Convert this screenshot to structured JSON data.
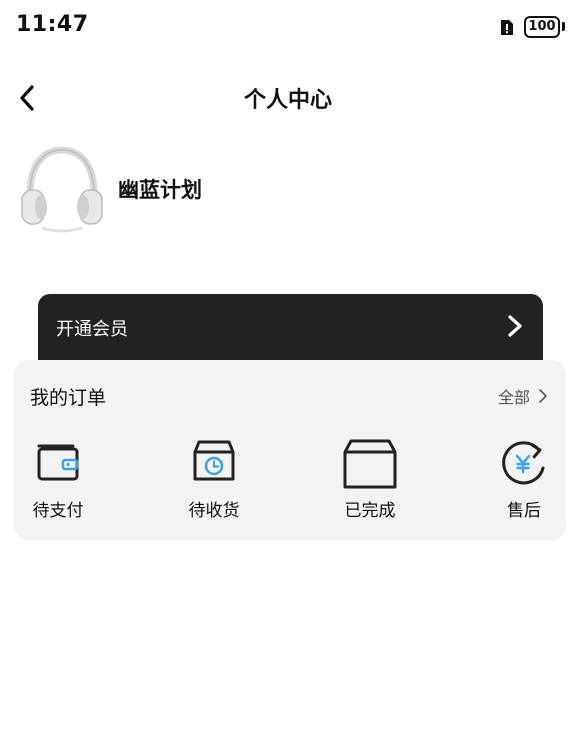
{
  "status_bar": {
    "time": "11:47",
    "battery_level": "100"
  },
  "nav": {
    "title": "个人中心"
  },
  "profile": {
    "username": "幽蓝计划"
  },
  "vip_banner": {
    "label": "开通会员"
  },
  "orders": {
    "title": "我的订单",
    "view_all": "全部",
    "items": [
      {
        "label": "待支付",
        "icon": "wallet-icon"
      },
      {
        "label": "待收货",
        "icon": "package-clock-icon"
      },
      {
        "label": "已完成",
        "icon": "box-icon"
      },
      {
        "label": "售后",
        "icon": "yen-refresh-icon"
      }
    ]
  },
  "colors": {
    "accent": "#3f9fe8",
    "banner_bg": "#222222",
    "card_bg": "#f3f3f3"
  }
}
